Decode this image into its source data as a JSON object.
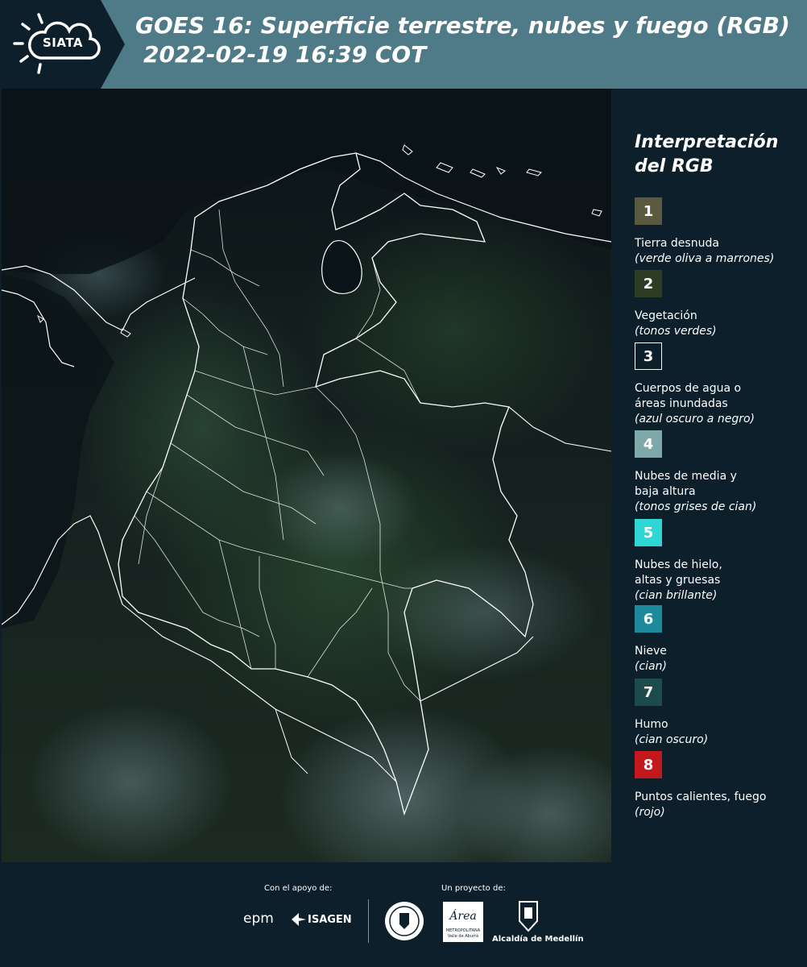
{
  "header": {
    "logo_text": "SIATA",
    "title_line1": "GOES 16: Superficie terrestre, nubes y fuego (RGB)",
    "title_line2": "2022-02-19 16:39 COT"
  },
  "legend": {
    "title_line1": "Interpretación",
    "title_line2": "del RGB",
    "items": [
      {
        "num": "1",
        "color": "#5a5a40",
        "label": "Tierra desnuda",
        "sub": "(verde oliva a marrones)"
      },
      {
        "num": "2",
        "color": "#2c3d22",
        "label": "Vegetación",
        "sub": "(tonos verdes)"
      },
      {
        "num": "3",
        "color": "#0d1f2b",
        "label": "Cuerpos de agua o áreas inundadas",
        "sub": "(azul oscuro a negro)"
      },
      {
        "num": "4",
        "color": "#7fa8a8",
        "label": "Nubes de media y baja altura",
        "sub": "(tonos grises de cian)"
      },
      {
        "num": "5",
        "color": "#2ed6d6",
        "label": "Nubes de hielo, altas y gruesas",
        "sub": "(cian brillante)"
      },
      {
        "num": "6",
        "color": "#1c8a9a",
        "label": "Nieve",
        "sub": "(cian)"
      },
      {
        "num": "7",
        "color": "#1d4a4a",
        "label": "Humo",
        "sub": "(cian oscuro)"
      },
      {
        "num": "8",
        "color": "#c4191c",
        "label": "Puntos calientes, fuego",
        "sub": "(rojo)"
      }
    ]
  },
  "footer": {
    "support_label": "Con el apoyo de:",
    "project_label": "Un proyecto de:",
    "epm": "epm",
    "isagen": "ISAGEN",
    "area_metro": "Área",
    "area_metro_sub": "METROPOLITANA",
    "area_metro_sub2": "Valle de Aburrá",
    "alcaldia": "Alcaldía de Medellín"
  },
  "colors": {
    "header_bg": "#4f7a88",
    "logo_bg": "#0d1f2b",
    "page_bg": "#0d1f2b",
    "border_white": "#ffffff"
  }
}
